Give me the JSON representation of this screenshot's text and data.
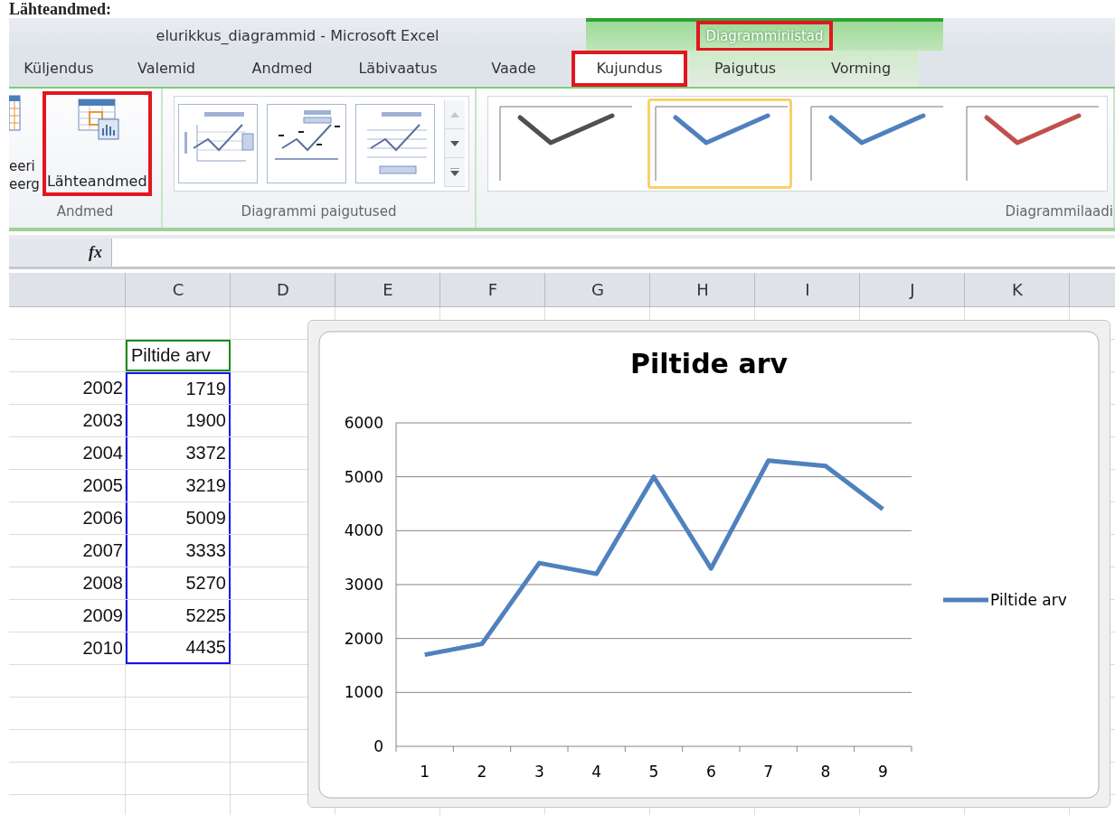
{
  "heading": "Lähteandmed:",
  "window": {
    "title": "elurikkus_diagrammid  -  Microsoft Excel",
    "context_group": {
      "label": "Diagrammiriistad",
      "highlighted": true
    }
  },
  "tabs": [
    {
      "label": "Küljendus",
      "selected": false,
      "highlighted": false,
      "contextual": false
    },
    {
      "label": "Valemid",
      "selected": false,
      "highlighted": false,
      "contextual": false
    },
    {
      "label": "Andmed",
      "selected": false,
      "highlighted": false,
      "contextual": false
    },
    {
      "label": "Läbivaatus",
      "selected": false,
      "highlighted": false,
      "contextual": false
    },
    {
      "label": "Vaade",
      "selected": false,
      "highlighted": false,
      "contextual": false
    },
    {
      "label": "Kujundus",
      "selected": true,
      "highlighted": true,
      "contextual": true
    },
    {
      "label": "Paigutus",
      "selected": false,
      "highlighted": false,
      "contextual": true
    },
    {
      "label": "Vorming",
      "selected": false,
      "highlighted": false,
      "contextual": true
    }
  ],
  "ribbon": {
    "data_group": {
      "label": "Andmed",
      "partial_button": [
        "eeri",
        "eerg"
      ],
      "button": {
        "label": "Lähteandmed",
        "highlighted": true
      }
    },
    "layouts_group": {
      "label": "Diagrammi paigutused",
      "layouts": [
        {
          "kind": "legend-right"
        },
        {
          "kind": "data-labels"
        },
        {
          "kind": "legend-bottom"
        }
      ]
    },
    "styles_group": {
      "label": "Diagrammilaadi",
      "styles": [
        {
          "color": "#505050",
          "selected": false
        },
        {
          "color": "#4f81bd",
          "selected": true
        },
        {
          "color": "#4f81bd",
          "selected": false
        },
        {
          "color": "#c0504d",
          "selected": false
        }
      ]
    }
  },
  "formula_bar": {
    "function_label": "fx"
  },
  "sheet": {
    "columns": [
      "C",
      "D",
      "E",
      "F",
      "G",
      "H",
      "I",
      "J",
      "K"
    ],
    "header": "Piltide arv",
    "rows": [
      {
        "year": "2002",
        "value": "1719"
      },
      {
        "year": "2003",
        "value": "1900"
      },
      {
        "year": "2004",
        "value": "3372"
      },
      {
        "year": "2005",
        "value": "3219"
      },
      {
        "year": "2006",
        "value": "5009"
      },
      {
        "year": "2007",
        "value": "3333"
      },
      {
        "year": "2008",
        "value": "5270"
      },
      {
        "year": "2009",
        "value": "5225"
      },
      {
        "year": "2010",
        "value": "4435"
      }
    ]
  },
  "chart": {
    "chart_data": {
      "type": "line",
      "title": "Piltide arv",
      "categories": [
        "1",
        "2",
        "3",
        "4",
        "5",
        "6",
        "7",
        "8",
        "9"
      ],
      "series": [
        {
          "name": "Piltide arv",
          "color": "#4f81bd",
          "values": [
            1700,
            1900,
            3400,
            3200,
            5000,
            3300,
            5300,
            5200,
            4400
          ]
        }
      ],
      "grid": true,
      "ylim": [
        0,
        6000
      ],
      "yticks": [
        0,
        1000,
        2000,
        3000,
        4000,
        5000,
        6000
      ]
    }
  }
}
